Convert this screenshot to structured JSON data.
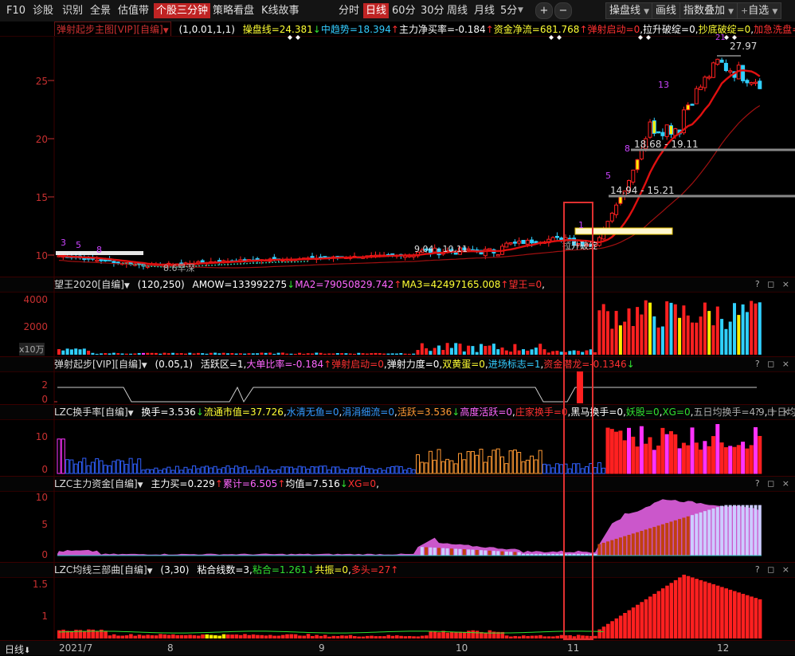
{
  "toolbar": {
    "left_items": [
      "F10",
      "诊股",
      "识别",
      "全景",
      "估值带",
      "个股三分钟",
      "策略看盘",
      "K线故事"
    ],
    "active_left": "个股三分钟",
    "periods": [
      "分时",
      "日线",
      "60分",
      "30分",
      "周线",
      "月线",
      "5分"
    ],
    "active_period": "日线",
    "zoom_in": "+",
    "zoom_out": "−",
    "right_items": [
      "操盘线",
      "画线",
      "指数叠加",
      "自选"
    ]
  },
  "main_pane": {
    "title": "弹射起步主图[VIP][自编]",
    "params": "(1,0.01,1,1)",
    "values": [
      {
        "text": "操盘线=24.381",
        "arrow": "↓",
        "color": "#ffff33",
        "arrow_color": "#30e030"
      },
      {
        "text": "中趋势=18.394",
        "arrow": "↑",
        "color": "#33ccff",
        "arrow_color": "#ff3030"
      },
      {
        "text": "主力净买率=-0.184",
        "arrow": "↑",
        "color": "#ffffff",
        "arrow_color": "#ff3030"
      },
      {
        "text": "资金净流=681.768",
        "arrow": "↑",
        "color": "#ffff33",
        "arrow_color": "#ff3030"
      },
      {
        "text": "弹射启动=0",
        "arrow": "",
        "color": "#ff3030",
        "arrow_color": ""
      },
      {
        "text": "拉升破绽=0",
        "arrow": "",
        "color": "#ffffff",
        "arrow_color": ""
      },
      {
        "text": "抄底破绽=0",
        "arrow": "",
        "color": "#ffff33",
        "arrow_color": ""
      },
      {
        "text": "加急洗盘=0",
        "arrow": "",
        "color": "#ff3030",
        "arrow_color": ""
      },
      {
        "text": "控价争夺",
        "arrow": "",
        "color": "#ff66ff",
        "arrow_color": ""
      }
    ],
    "y_labels": [
      "25",
      "20",
      "15",
      "10"
    ],
    "annotations": {
      "high": "27.97",
      "range1": "18.68 - 19.11",
      "range2": "14.94 - 15.21",
      "low": "8.6",
      "low_text": "8.6早深",
      "mid_label": "9.04 - 10.11",
      "breakout": "拉升破绽",
      "count_13": "13",
      "count_8": "8",
      "count_5": "5",
      "count_1": "1",
      "left_3": "3",
      "left_5": "5",
      "left_8": "8",
      "top_21": "21"
    }
  },
  "vol_pane": {
    "title": "望王2020[自编]",
    "params": "(120,250)",
    "values": [
      {
        "text": "AMOW=133992275",
        "arrow": "↓",
        "color": "#ffffff",
        "arrow_color": "#30e030"
      },
      {
        "text": "MA2=79050829.742",
        "arrow": "↑",
        "color": "#ff66ff",
        "arrow_color": "#ff3030"
      },
      {
        "text": "MA3=42497165.008",
        "arrow": "↑",
        "color": "#ffff33",
        "arrow_color": "#ff3030"
      },
      {
        "text": "望王=0",
        "arrow": "",
        "color": "#ff3030",
        "arrow_color": ""
      }
    ],
    "y_labels": [
      "4000",
      "2000"
    ],
    "unit": "x10万"
  },
  "jump_pane": {
    "title": "弹射起步[VIP][自编]",
    "params": "(0.05,1)",
    "values": [
      {
        "text": "活跃区=1",
        "arrow": ",",
        "color": "#ffffff",
        "arrow_color": "#ffffff"
      },
      {
        "text": "大单比率=-0.184",
        "arrow": "↑",
        "color": "#ff66ff",
        "arrow_color": "#ff3030"
      },
      {
        "text": "弹射启动=0",
        "arrow": "",
        "color": "#ff3030",
        "arrow_color": ""
      },
      {
        "text": "弹射力度=0",
        "arrow": "",
        "color": "#ffffff",
        "arrow_color": ""
      },
      {
        "text": "双黄蛋=0",
        "arrow": "",
        "color": "#ffff33",
        "arrow_color": ""
      },
      {
        "text": "进场标志=1",
        "arrow": "",
        "color": "#33ccff",
        "arrow_color": ""
      },
      {
        "text": "资金潜龙=-0.1346",
        "arrow": "↓",
        "color": "#ff3030",
        "arrow_color": "#30e030"
      }
    ],
    "y_labels": [
      "2",
      "0"
    ]
  },
  "turnover_pane": {
    "title": "LZC换手率[自编]",
    "values": [
      {
        "text": "换手=3.536",
        "arrow": "↓",
        "color": "#ffffff",
        "arrow_color": "#30e030"
      },
      {
        "text": "流通市值=37.726",
        "arrow": "",
        "color": "#ffff33",
        "arrow_color": ""
      },
      {
        "text": "水清无鱼=0",
        "arrow": "",
        "color": "#3399ff",
        "arrow_color": ""
      },
      {
        "text": "涓涓细流=0",
        "arrow": "",
        "color": "#3399ff",
        "arrow_color": ""
      },
      {
        "text": "活跃=3.536",
        "arrow": "↓",
        "color": "#ff9933",
        "arrow_color": "#30e030"
      },
      {
        "text": "高度活跃=0",
        "arrow": "",
        "color": "#ff66ff",
        "arrow_color": ""
      },
      {
        "text": "庄家换手=0",
        "arrow": "",
        "color": "#ff3030",
        "arrow_color": ""
      },
      {
        "text": "黑马换手=0",
        "arrow": "",
        "color": "#ffffff",
        "arrow_color": ""
      },
      {
        "text": "妖股=0",
        "arrow": "",
        "color": "#30e030",
        "arrow_color": ""
      },
      {
        "text": "XG=0",
        "arrow": "",
        "color": "#30e030",
        "arrow_color": ""
      },
      {
        "text": "五日均换手=4.9",
        "arrow": "",
        "color": "#aaaaaa",
        "arrow_color": ""
      },
      {
        "text": "十日均换手",
        "arrow": "",
        "color": "#aaaaaa",
        "arrow_color": ""
      }
    ],
    "y_labels": [
      "10",
      "0"
    ]
  },
  "fund_pane": {
    "title": "LZC主力资金[自编]",
    "values": [
      {
        "text": "主力买=0.229",
        "arrow": "↑",
        "color": "#ffffff",
        "arrow_color": "#ff3030"
      },
      {
        "text": "累计=6.505",
        "arrow": "↑",
        "color": "#ff66ff",
        "arrow_color": "#ff3030"
      },
      {
        "text": "均值=7.516",
        "arrow": "↓",
        "color": "#ffffff",
        "arrow_color": "#30e030"
      },
      {
        "text": "XG=0",
        "arrow": "",
        "color": "#ff3030",
        "arrow_color": ""
      }
    ],
    "y_labels": [
      "10",
      "5",
      "0"
    ]
  },
  "ma_pane": {
    "title": "LZC均线三部曲[自编]",
    "params": "(3,30)",
    "values": [
      {
        "text": "粘合线数=3",
        "arrow": ",",
        "color": "#ffffff",
        "arrow_color": "#ffffff"
      },
      {
        "text": "粘合=1.261",
        "arrow": "↓",
        "color": "#30e030",
        "arrow_color": "#30e030"
      },
      {
        "text": "共振=0",
        "arrow": ",",
        "color": "#ffff33",
        "arrow_color": "#ffffff"
      },
      {
        "text": "多头=27",
        "arrow": "↑",
        "color": "#ff3030",
        "arrow_color": "#ff3030"
      }
    ],
    "y_labels": [
      "1.5",
      "1"
    ]
  },
  "bottom": {
    "period_label": "日线",
    "x_labels": [
      "2021/7",
      "8",
      "9",
      "10",
      "11",
      "12"
    ]
  },
  "window_controls": "? ◻ ×",
  "colors": {
    "up": "#ff2020",
    "down": "#30d0ff",
    "ma_red": "#e01010",
    "grid": "#3a0000"
  }
}
